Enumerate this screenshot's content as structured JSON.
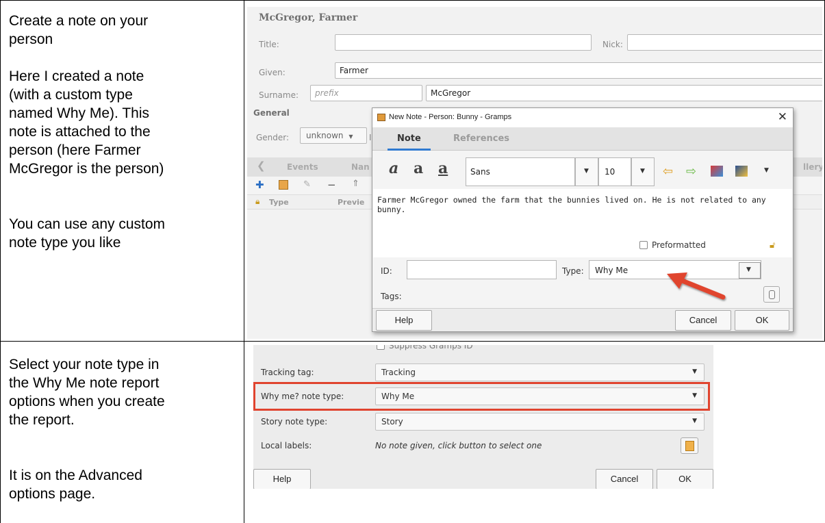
{
  "left_column": {
    "cell1_paragraphs": [
      [
        "Create a note on your",
        "person"
      ],
      [
        "Here I created a note",
        "(with a custom type",
        "named Why Me).  This",
        "note is attached to the",
        "person (here Farmer",
        "McGregor is the person)"
      ],
      [
        "You can use any custom",
        "note type you like"
      ]
    ],
    "cell2_paragraphs": [
      [
        "Select your note type in",
        "the Why Me note report",
        "options when you create",
        "the report."
      ],
      [
        "It is on the Advanced",
        "options page."
      ]
    ]
  },
  "person_editor": {
    "heading": "McGregor, Farmer",
    "title_label": "Title:",
    "nick_label": "Nick:",
    "given_label": "Given:",
    "given_value": "Farmer",
    "surname_label": "Surname:",
    "surname_prefix_placeholder": "prefix",
    "surname_value": "McGregor",
    "general_label": "General",
    "gender_label": "Gender:",
    "gender_value": "unknown",
    "id_partial": "II",
    "tabs": [
      "Events",
      "Nan",
      "llery"
    ],
    "columns": [
      "Type",
      "Previe"
    ]
  },
  "note_dialog": {
    "title": "New Note - Person: Bunny - Gramps",
    "close_glyph": "✕",
    "tab_note": "Note",
    "tab_references": "References",
    "font_name": "Sans",
    "font_size": "10",
    "note_text_lines": [
      "Farmer McGregor owned the farm that the bunnies lived on.  He is not related to any",
      "bunny."
    ],
    "preformatted_label": "Preformatted",
    "id_label": "ID:",
    "type_label": "Type:",
    "type_value": "Why Me",
    "tags_label": "Tags:",
    "help_button": "Help",
    "cancel_button": "Cancel",
    "ok_button": "OK"
  },
  "report_options": {
    "suppress_label": "Suppress Gramps ID",
    "rows": [
      {
        "label": "Tracking tag:",
        "value": "Tracking"
      },
      {
        "label": "Why me? note type:",
        "value": "Why Me"
      },
      {
        "label": "Story note type:",
        "value": "Story"
      }
    ],
    "local_labels_label": "Local labels:",
    "local_labels_value": "No note given, click button to select one",
    "help_button": "Help",
    "cancel_button": "Cancel",
    "ok_button": "OK"
  },
  "colors": {
    "highlight": "#e0442f",
    "arrow": "#e0442f",
    "tab_accent": "#2f7ad1"
  }
}
